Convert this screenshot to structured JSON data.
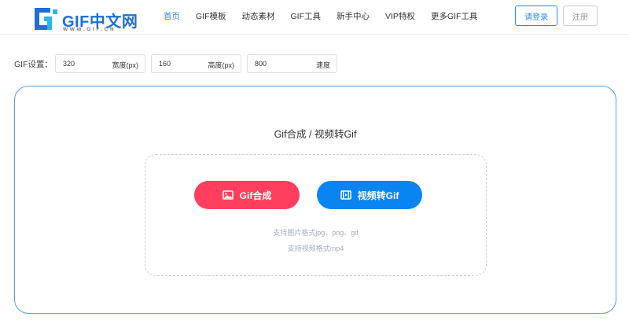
{
  "header": {
    "logo_text": "GIF中文网",
    "logo_sub": "WWW.GIF.CN",
    "nav": [
      {
        "label": "首页",
        "active": true
      },
      {
        "label": "GIF模板",
        "active": false
      },
      {
        "label": "动态素材",
        "active": false
      },
      {
        "label": "GIF工具",
        "active": false
      },
      {
        "label": "新手中心",
        "active": false
      },
      {
        "label": "VIP特权",
        "active": false
      },
      {
        "label": "更多GIF工具",
        "active": false
      }
    ],
    "login_label": "请登录",
    "register_label": "注册"
  },
  "settings": {
    "label": "GIF设置：",
    "width": {
      "value": "320",
      "unit": "宽度(px)"
    },
    "height": {
      "value": "160",
      "unit": "高度(px)"
    },
    "speed": {
      "value": "800",
      "unit": "速度"
    }
  },
  "main": {
    "title": "Gif合成 / 视频转Gif",
    "gif_button_label": "Gif合成",
    "video_button_label": "视频转Gif",
    "hint_images": "支持图片格式jpg、png、gif",
    "hint_video": "支持视频格式mp4"
  },
  "colors": {
    "accent": "#2d8cf0",
    "gif_button": "#ff3f5d",
    "video_button": "#0a84f0",
    "card_border": "#5b9be8"
  }
}
